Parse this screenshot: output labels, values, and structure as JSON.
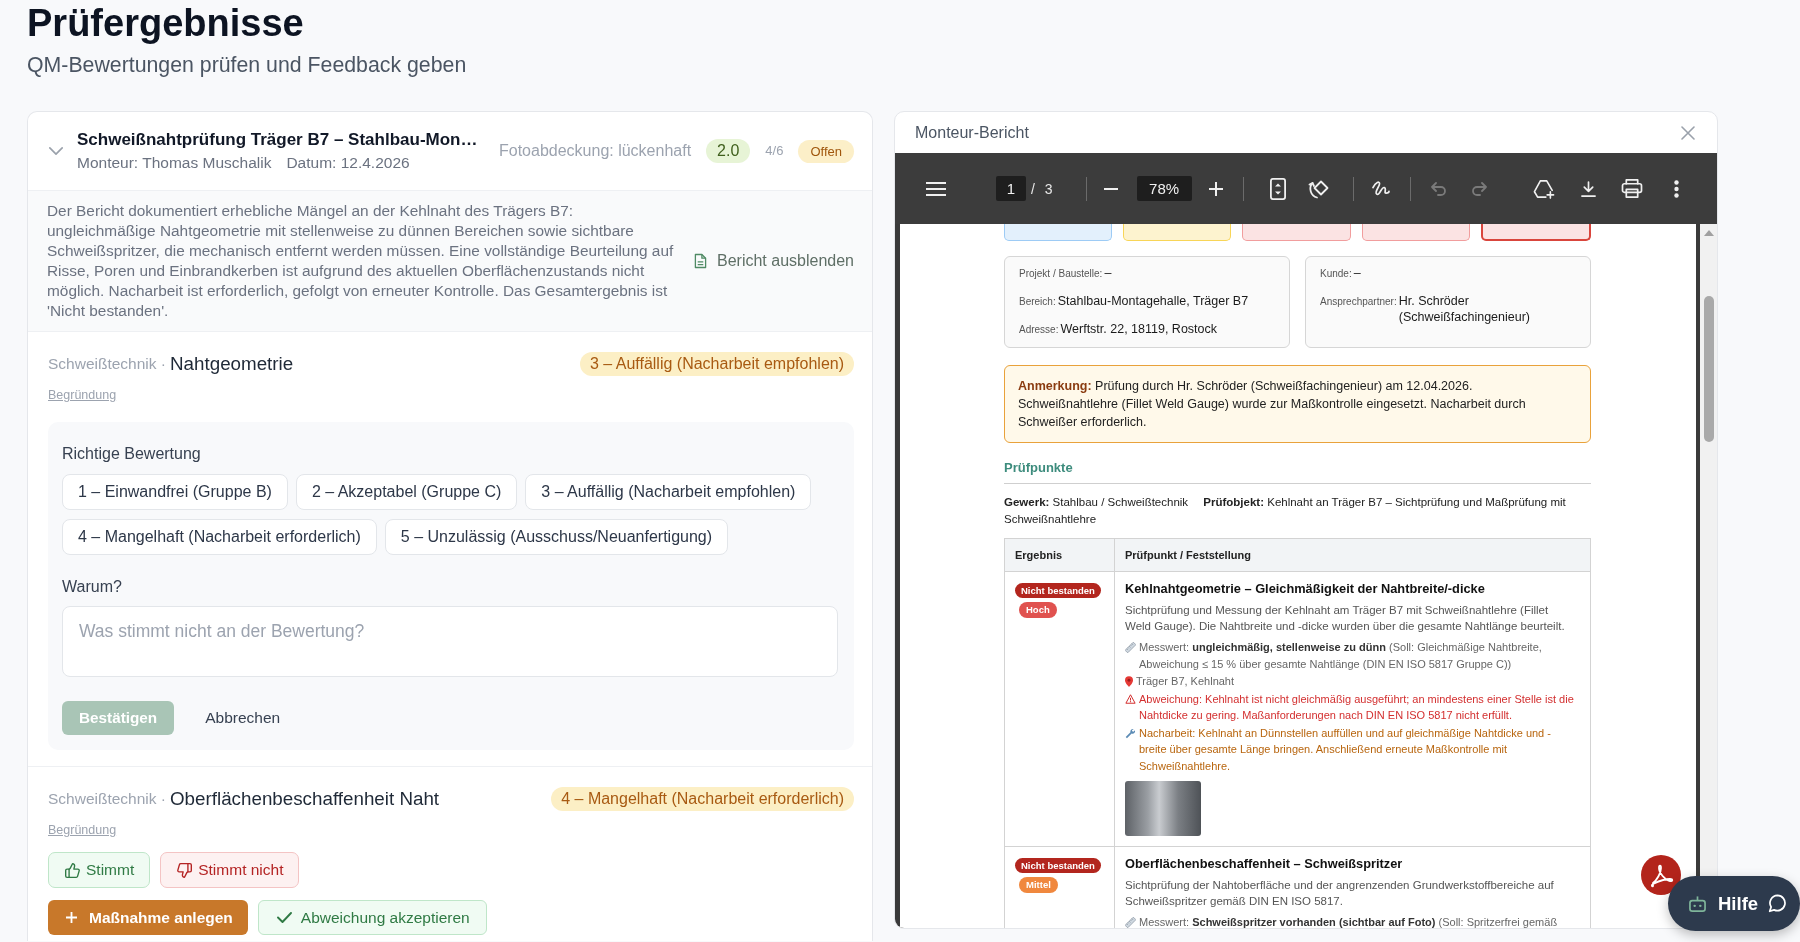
{
  "page": {
    "title": "Prüfergebnisse",
    "subtitle": "QM-Bewertungen prüfen und Feedback geben"
  },
  "report_card": {
    "expanded": true,
    "title": "Schweißnahtprüfung Träger B7 – Stahlbau-Mon…",
    "fitter": "Monteur: Thomas Muschalik",
    "date": "Datum: 12.4.2026",
    "photo_coverage": "Fotoabdeckung: lückenhaft",
    "score": "2.0",
    "progress": "4/6",
    "status": "Offen",
    "summary": "Der Bericht dokumentiert erhebliche Mängel an der Kehlnaht des Trägers B7: ungleichmäßige Nahtgeometrie mit stellenweise zu dünnen Bereichen sowie sichtbare Schweißspritzer, die mechanisch entfernt werden müssen. Eine vollständige Beurteilung auf Risse, Poren und Einbrandkerben ist aufgrund des aktuellen Oberflächenzustands nicht möglich. Nacharbeit ist erforderlich, gefolgt von erneuter Kontrolle. Das Gesamtergebnis ist 'Nicht bestanden'.",
    "report_toggle": "Bericht ausblenden",
    "criteria": [
      {
        "kind": "correction_form",
        "category": "Schweißtechnik ·",
        "name": "Nahtgeometrie",
        "rating": "3 – Auffällig (Nacharbeit empfohlen)",
        "reason_link": "Begründung",
        "correction": {
          "label": "Richtige Bewertung",
          "options": [
            {
              "label": "1 – Einwandfrei (Gruppe B)",
              "selected": false
            },
            {
              "label": "2 – Akzeptabel (Gruppe C)",
              "selected": false
            },
            {
              "label": "3 – Auffällig (Nacharbeit empfohlen)",
              "selected": false
            },
            {
              "label": "4 – Mangelhaft (Nacharbeit erforderlich)",
              "selected": false
            },
            {
              "label": "5 – Unzulässig (Ausschuss/Neuanfertigung)",
              "selected": false
            }
          ],
          "why_label": "Warum?",
          "why_field": {
            "placeholder": "Was stimmt nicht an der Bewertung?"
          },
          "confirm": {
            "label": "Bestätigen",
            "disabled": true
          },
          "cancel": "Abbrechen"
        }
      },
      {
        "kind": "verdict",
        "category": "Schweißtechnik ·",
        "name": "Oberflächenbeschaffenheit Naht",
        "rating": "4 – Mangelhaft (Nacharbeit erforderlich)",
        "reason_link": "Begründung",
        "buttons": [
          {
            "kind": "agree",
            "label": "Stimmt"
          },
          {
            "kind": "disagree",
            "label": "Stimmt nicht"
          }
        ],
        "actions": [
          {
            "kind": "create",
            "label": "Maßnahme anlegen"
          },
          {
            "kind": "accept",
            "label": "Abweichung akzeptieren"
          }
        ]
      }
    ]
  },
  "report_viewer": {
    "title": "Monteur-Bericht",
    "toolbar": {
      "page": "1",
      "page_count": "/ 3",
      "zoom": "78%",
      "undo_disabled": true,
      "redo_disabled": true
    },
    "document": {
      "status_tiles": [
        {
          "color": "#e3f0fc",
          "highlighted": false
        },
        {
          "color": "#fdf3cf",
          "highlighted": false
        },
        {
          "color": "#fbe3e3",
          "highlighted": false
        },
        {
          "color": "#fbe3e3",
          "highlighted": false
        },
        {
          "color": "#fbe3e3",
          "highlighted": true
        }
      ],
      "info_cards": [
        {
          "lines": [
            {
              "label": "Projekt / Baustelle:",
              "value": "–"
            },
            {
              "label": "Bereich:",
              "value": "Stahlbau-Montagehalle, Träger B7"
            },
            {
              "label": "Adresse:",
              "value": "Werftstr. 22, 18119, Rostock"
            }
          ]
        },
        {
          "lines": [
            {
              "label": "Kunde:",
              "value": "–"
            },
            {
              "label": "Ansprechpartner:",
              "value": "Hr. Schröder (Schweißfachingenieur)"
            }
          ]
        }
      ],
      "note": "**Anmerkung:** Prüfung durch Hr. Schröder (Schweißfachingenieur) am 12.04.2026. Schweißnahtlehre (Fillet Weld Gauge) wurde zur Maßkontrolle eingesetzt. Nacharbeit durch Schweißer erforderlich.",
      "section_title": "Prüfpunkte",
      "scope": "**Gewerk:** Stahlbau / Schweißtechnik **Prüfobjekt:** Kehlnaht an Träger B7 – Sichtprüfung und Maßprüfung mit Schweißnahtlehre",
      "table": {
        "columns": [
          "Ergebnis",
          "Prüfpunkt / Feststellung"
        ],
        "rows": [
          {
            "result": {
              "label": "Nicht bestanden",
              "kind": "fail"
            },
            "severity": {
              "label": "Hoch",
              "kind": "high"
            },
            "title": "Kehlnahtgeometrie – Gleichmäßigkeit der Nahtbreite/-dicke",
            "description": "Sichtprüfung und Messung der Kehlnaht am Träger B7 mit Schweißnahtlehre (Fillet Weld Gauge). Die Nahtbreite und -dicke wurden über die gesamte Nahtlänge beurteilt.",
            "findings": [
              {
                "kind": "measurement",
                "text": "Messwert: **ungleichmäßig, stellenweise zu dünn** (Soll: Gleichmäßige Nahtbreite, Abweichung ≤ 15 % über gesamte Nahtlänge (DIN EN ISO 5817 Gruppe C))"
              },
              {
                "kind": "location",
                "text": "Träger B7, Kehlnaht"
              },
              {
                "kind": "deviation",
                "text": "Abweichung: Kehlnaht ist nicht gleichmäßig ausgeführt; an mindestens einer Stelle ist die Nahtdicke zu gering. Maßanforderungen nach DIN EN ISO 5817 nicht erfüllt."
              },
              {
                "kind": "rework",
                "text": "Nacharbeit: Kehlnaht an Dünnstellen auffüllen und auf gleichmäßige Nahtdicke und -breite über gesamte Länge bringen. Anschließend erneute Maßkontrolle mit Schweißnahtlehre."
              }
            ],
            "photo": true
          },
          {
            "result": {
              "label": "Nicht bestanden",
              "kind": "fail"
            },
            "severity": {
              "label": "Mittel",
              "kind": "medium"
            },
            "title": "Oberflächenbeschaffenheit – Schweißspritzer",
            "description": "Sichtprüfung der Nahtoberfläche und der angrenzenden Grundwerkstoffbereiche auf Schweißspritzer gemäß DIN EN ISO 5817.",
            "findings": [
              {
                "kind": "measurement",
                "text": "Messwert: **Schweißspritzer vorhanden (sichtbar auf Foto)** (Soll: Spritzerfrei gemäß"
              }
            ]
          }
        ]
      }
    }
  },
  "help_button": {
    "label": "Hilfe"
  }
}
